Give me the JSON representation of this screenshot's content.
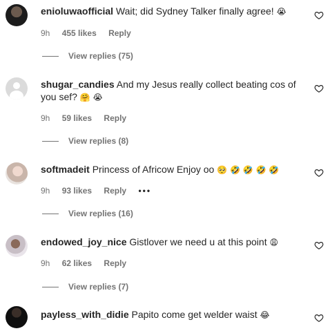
{
  "comments": [
    {
      "username": "enioluwaofficial",
      "text": "Wait; did Sydney Talker finally agree!",
      "emojis": "😭",
      "time": "9h",
      "likes": "455 likes",
      "reply": "Reply",
      "view_replies": "View replies (75)"
    },
    {
      "username": "shugar_candies",
      "text": "And my Jesus really collect beating cos of you sef?",
      "emojis": "🤗 😭",
      "time": "9h",
      "likes": "59 likes",
      "reply": "Reply",
      "view_replies": "View replies (8)"
    },
    {
      "username": "softmadeit",
      "text": "Princess of Africow Enjoy oo",
      "emojis": "🥺 🤣 🤣 🤣 🤣",
      "time": "9h",
      "likes": "93 likes",
      "reply": "Reply",
      "more": "•••",
      "view_replies": "View replies (16)"
    },
    {
      "username": "endowed_joy_nice",
      "text": "Gistlover we need u at this point",
      "emojis": "😩",
      "time": "9h",
      "likes": "62 likes",
      "reply": "Reply",
      "view_replies": "View replies (7)"
    },
    {
      "username": "payless_with_didie",
      "text": "Papito come get welder waist",
      "emojis": "😂"
    }
  ]
}
